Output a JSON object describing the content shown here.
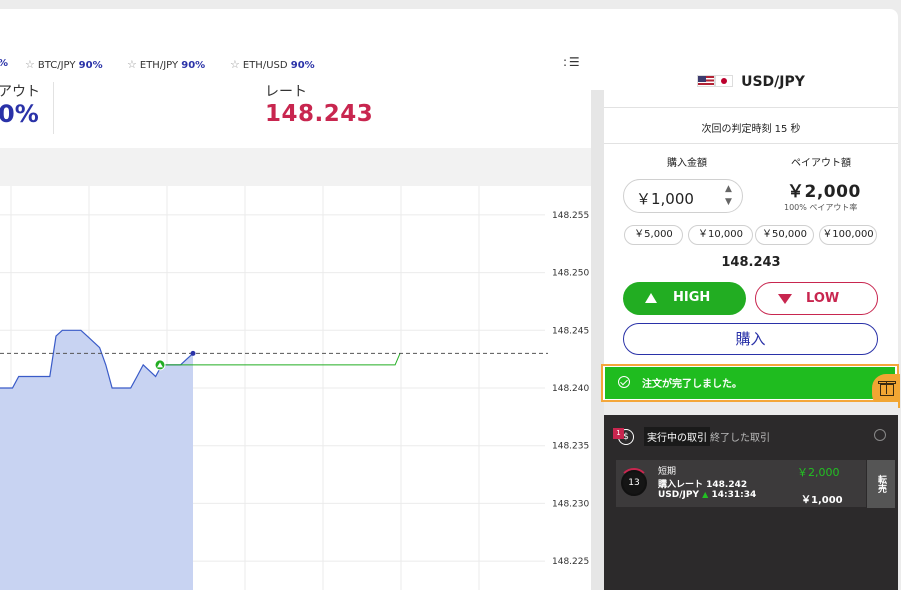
{
  "favorites": [
    {
      "name": "",
      "pct": "%"
    },
    {
      "name": "BTC/JPY",
      "pct": "90%"
    },
    {
      "name": "ETH/JPY",
      "pct": "90%"
    },
    {
      "name": "ETH/USD",
      "pct": "90%"
    }
  ],
  "menu_icon": ": ☰",
  "stats": {
    "payout_label": "アウト",
    "payout_value": "0%",
    "rate_label": "レート",
    "rate_value": "148.243"
  },
  "chart_data": {
    "type": "line",
    "series": [
      {
        "values": [
          148.24,
          148.24,
          148.24,
          148.241,
          148.241,
          148.241,
          148.241,
          148.241,
          148.241,
          148.2445,
          148.245,
          148.245,
          148.245,
          148.245,
          148.2445,
          148.244,
          148.2435,
          148.242,
          148.24,
          148.24,
          148.24,
          148.24,
          148.241,
          148.242,
          148.2415,
          148.241,
          148.242,
          148.242,
          148.242,
          148.242,
          148.2425,
          148.243
        ]
      },
      {
        "values": [
          148.242,
          148.242,
          148.242,
          148.242,
          148.242,
          148.242,
          148.242,
          148.242,
          148.242,
          148.242,
          148.242,
          148.242,
          148.242,
          148.242,
          148.242,
          148.242,
          148.242,
          148.242,
          148.242,
          148.242,
          148.242,
          148.242,
          148.242,
          148.242,
          148.242,
          148.242,
          148.242,
          148.242,
          148.242,
          148.242,
          148.242,
          148.242,
          148.242,
          148.242,
          148.242,
          148.242,
          148.242,
          148.242,
          148.242,
          148.242,
          148.242,
          148.242,
          148.242,
          148.242,
          148.242,
          148.242,
          148.242,
          148.242,
          148.242,
          148.243
        ]
      }
    ],
    "entry_rate": 148.242,
    "current_rate": 148.243,
    "ylim": [
      148.2225,
      148.2575
    ],
    "yticks": [
      "148.255",
      "148.250",
      "148.245",
      "148.240",
      "148.235",
      "148.230",
      "148.225"
    ],
    "ytick_values": [
      148.255,
      148.25,
      148.245,
      148.24,
      148.235,
      148.23,
      148.225
    ],
    "grid": true
  },
  "order": {
    "pair": "USD/JPY",
    "next_judge": "次回の判定時刻 15 秒",
    "amount_label": "購入金額",
    "payout_label": "ペイアウト額",
    "amount": "￥1,000",
    "stepper_up": "▲",
    "stepper_down": "▼",
    "payout_amount": "￥2,000",
    "payout_rate": "100% ペイアウト率",
    "presets": [
      "￥5,000",
      "￥10,000",
      "￥50,000",
      "￥100,000"
    ],
    "rate": "148.243",
    "high": "HIGH",
    "low": "LOW",
    "buy": "購入"
  },
  "toast": {
    "text": "注文が完了しました。"
  },
  "trades": {
    "badge": "1",
    "icon": "$",
    "tab_active": "実行中の取引",
    "tab_done": "終了した取引",
    "card": {
      "countdown": "13",
      "type": "短期",
      "buy_rate": "購入レート 148.242",
      "pair": "USD/JPY",
      "arrow": "▲",
      "time": "14:31:34",
      "payout": "￥2,000",
      "amount": "￥1,000"
    },
    "resell": "転売"
  },
  "colors": {
    "brand_blue": "#2a32a8",
    "rate_red": "#c8264f",
    "high_green": "#22ad22",
    "toast_green": "#1fbc1f",
    "gift_orange": "#f2a633"
  }
}
